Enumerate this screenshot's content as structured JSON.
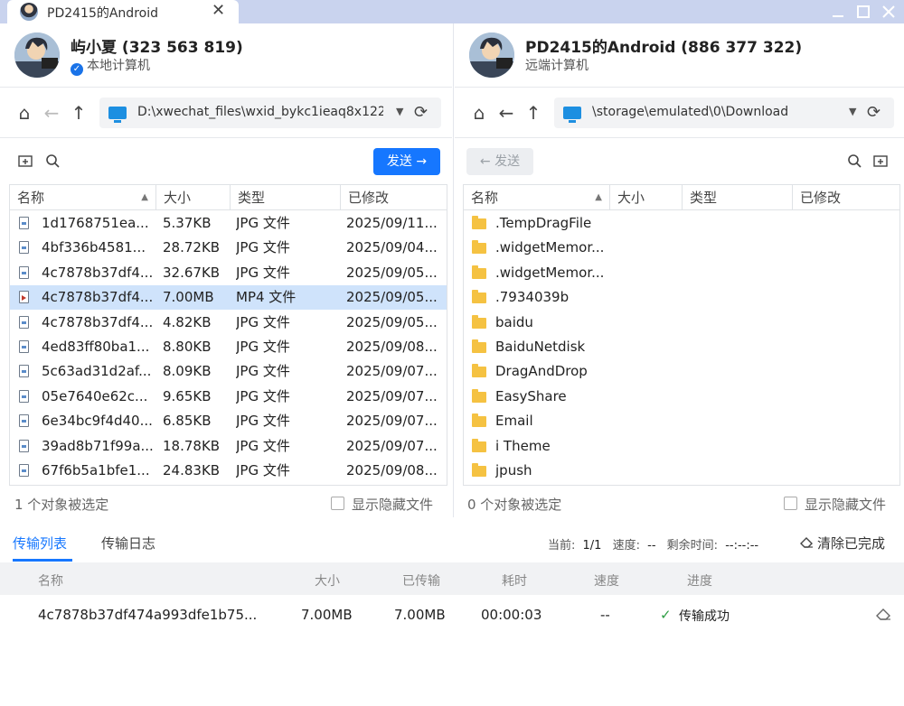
{
  "window": {
    "tab_title": "PD2415的Android",
    "close_glyph": "✕",
    "controls": [
      "minimize",
      "maximize",
      "close"
    ]
  },
  "left": {
    "user_name": "屿小夏 (323 563 819)",
    "user_sub": "本地计算机",
    "path": "D:\\xwechat_files\\wxid_bykc1ieaq8x122_",
    "send_label": "发送",
    "columns": [
      "名称",
      "大小",
      "类型",
      "已修改"
    ],
    "files": [
      {
        "name": "1d1768751ea...",
        "size": "5.37KB",
        "type": "JPG 文件",
        "modified": "2025/09/11..."
      },
      {
        "name": "4bf336b4581...",
        "size": "28.72KB",
        "type": "JPG 文件",
        "modified": "2025/09/04..."
      },
      {
        "name": "4c7878b37df4...",
        "size": "32.67KB",
        "type": "JPG 文件",
        "modified": "2025/09/05..."
      },
      {
        "name": "4c7878b37df4...",
        "size": "7.00MB",
        "type": "MP4 文件",
        "modified": "2025/09/05..."
      },
      {
        "name": "4c7878b37df4...",
        "size": "4.82KB",
        "type": "JPG 文件",
        "modified": "2025/09/05..."
      },
      {
        "name": "4ed83ff80ba1...",
        "size": "8.80KB",
        "type": "JPG 文件",
        "modified": "2025/09/08..."
      },
      {
        "name": "5c63ad31d2af...",
        "size": "8.09KB",
        "type": "JPG 文件",
        "modified": "2025/09/07..."
      },
      {
        "name": "05e7640e62c...",
        "size": "9.65KB",
        "type": "JPG 文件",
        "modified": "2025/09/07..."
      },
      {
        "name": "6e34bc9f4d40...",
        "size": "6.85KB",
        "type": "JPG 文件",
        "modified": "2025/09/07..."
      },
      {
        "name": "39ad8b71f99a...",
        "size": "18.78KB",
        "type": "JPG 文件",
        "modified": "2025/09/07..."
      },
      {
        "name": "67f6b5a1bfe1...",
        "size": "24.83KB",
        "type": "JPG 文件",
        "modified": "2025/09/08..."
      }
    ],
    "selected_index": 3,
    "status": "1 个对象被选定",
    "show_hidden_label": "显示隐藏文件"
  },
  "right": {
    "user_name": "PD2415的Android (886 377 322)",
    "user_sub": "远端计算机",
    "path": "\\storage\\emulated\\0\\Download",
    "send_label": "发送",
    "columns": [
      "名称",
      "大小",
      "类型",
      "已修改"
    ],
    "folders": [
      ".TempDragFile",
      ".widgetMemor...",
      ".widgetMemor...",
      ".7934039b",
      "baidu",
      "BaiduNetdisk",
      "DragAndDrop",
      "EasyShare",
      "Email",
      "i Theme",
      "jpush"
    ],
    "status": "0 个对象被选定",
    "show_hidden_label": "显示隐藏文件"
  },
  "transfer": {
    "tabs": [
      "传输列表",
      "传输日志"
    ],
    "active_tab": 0,
    "current_label": "当前:",
    "current_value": "1/1",
    "speed_label": "速度:",
    "speed_value": "--",
    "remaining_label": "剩余时间:",
    "remaining_value": "--:--:--",
    "clear_label": "清除已完成",
    "columns": [
      "名称",
      "大小",
      "已传输",
      "耗时",
      "速度",
      "进度"
    ],
    "rows": [
      {
        "name": "4c7878b37df474a993dfe1b75...",
        "size": "7.00MB",
        "transferred": "7.00MB",
        "elapsed": "00:00:03",
        "speed": "--",
        "progress": "传输成功"
      }
    ]
  },
  "colors": {
    "accent": "#1677ff",
    "titlebar": "#c9d3ee",
    "selected_row": "#cfe3fb",
    "folder": "#f5c242",
    "success": "#2f9e44"
  }
}
